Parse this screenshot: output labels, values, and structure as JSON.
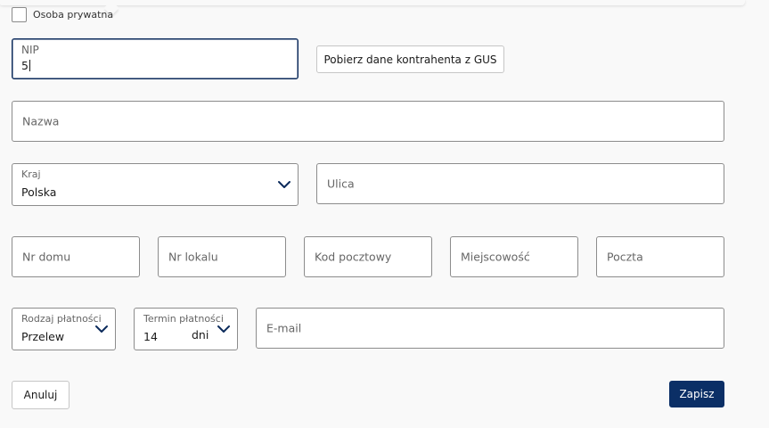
{
  "private_person": {
    "label": "Osoba prywatna",
    "checked": false
  },
  "nip": {
    "label": "NIP",
    "value": "5"
  },
  "gus_button": {
    "label": "Pobierz dane kontrahenta z GUS"
  },
  "name_field": {
    "placeholder": "Nazwa"
  },
  "country": {
    "label": "Kraj",
    "value": "Polska"
  },
  "street": {
    "placeholder": "Ulica"
  },
  "house_no": {
    "placeholder": "Nr domu"
  },
  "apartment_no": {
    "placeholder": "Nr lokalu"
  },
  "postal_code": {
    "placeholder": "Kod pocztowy"
  },
  "city": {
    "placeholder": "Miejscowość"
  },
  "post_office": {
    "placeholder": "Poczta"
  },
  "payment_type": {
    "label": "Rodzaj płatności",
    "value": "Przelew"
  },
  "payment_term": {
    "label": "Termin płatności",
    "value": "14",
    "unit": "dni"
  },
  "email": {
    "placeholder": "E-mail"
  },
  "actions": {
    "cancel": "Anuluj",
    "save": "Zapisz"
  },
  "colors": {
    "primary": "#0b2f66",
    "focus_border": "#0b2a5b",
    "field_border": "#8c8c8c"
  },
  "icons": {
    "dropdown": "chevron-down-icon"
  }
}
